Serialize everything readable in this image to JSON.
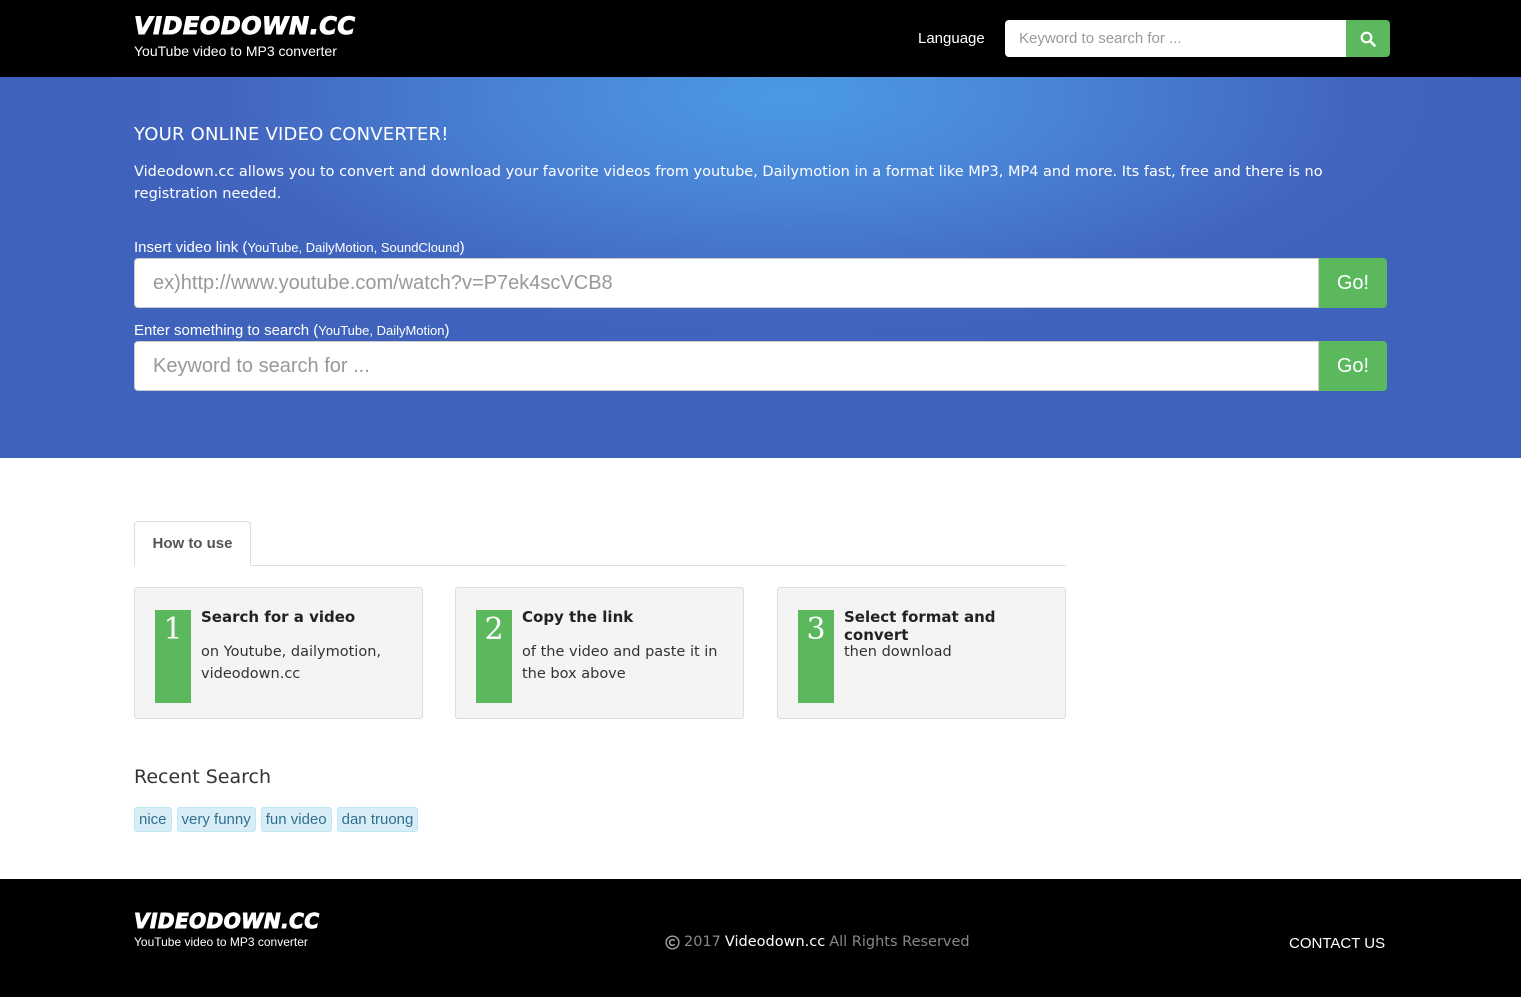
{
  "header": {
    "logo_main": "VIDEODOWN.CC",
    "logo_sub": "YouTube video to MP3 converter",
    "language_label": "Language",
    "search_placeholder": "Keyword to search for ..."
  },
  "hero": {
    "title": "YOUR ONLINE VIDEO CONVERTER!",
    "description": "Videodown.cc allows you to convert and download your favorite videos from youtube, Dailymotion in a format like MP3, MP4 and more. Its fast, free and there is no registration needed.",
    "link_label": "Insert video link (",
    "link_label_small": "YouTube, DailyMotion, SoundClound",
    "link_label_end": ")",
    "link_placeholder": "ex)http://www.youtube.com/watch?v=P7ek4scVCB8",
    "search_label": "Enter something to search (",
    "search_label_small": "YouTube, DailyMotion",
    "search_label_end": ")",
    "search_placeholder": "Keyword to search for ...",
    "go_label": "Go!"
  },
  "tabs": {
    "how_to_use": "How to use"
  },
  "steps": [
    {
      "num": "1",
      "title": "Search for a video",
      "text": "on Youtube, dailymotion, videodown.cc"
    },
    {
      "num": "2",
      "title": "Copy the link",
      "text": "of the video and paste it in the box above"
    },
    {
      "num": "3",
      "title": "Select format and convert",
      "text": "then download"
    }
  ],
  "recent": {
    "title": "Recent Search",
    "tags": [
      "nice",
      "very funny",
      "fun video",
      "dan truong"
    ]
  },
  "footer": {
    "logo_main": "VIDEODOWN.CC",
    "logo_sub": "YouTube video to MP3 converter",
    "copyright_year": "2017",
    "brand": "Videodown.cc",
    "rights": "All Rights Reserved",
    "contact": "CONTACT US"
  },
  "colors": {
    "accent_green": "#5cb85c",
    "hero_blue": "#4266c0",
    "tag_bg": "#d9edf7"
  }
}
